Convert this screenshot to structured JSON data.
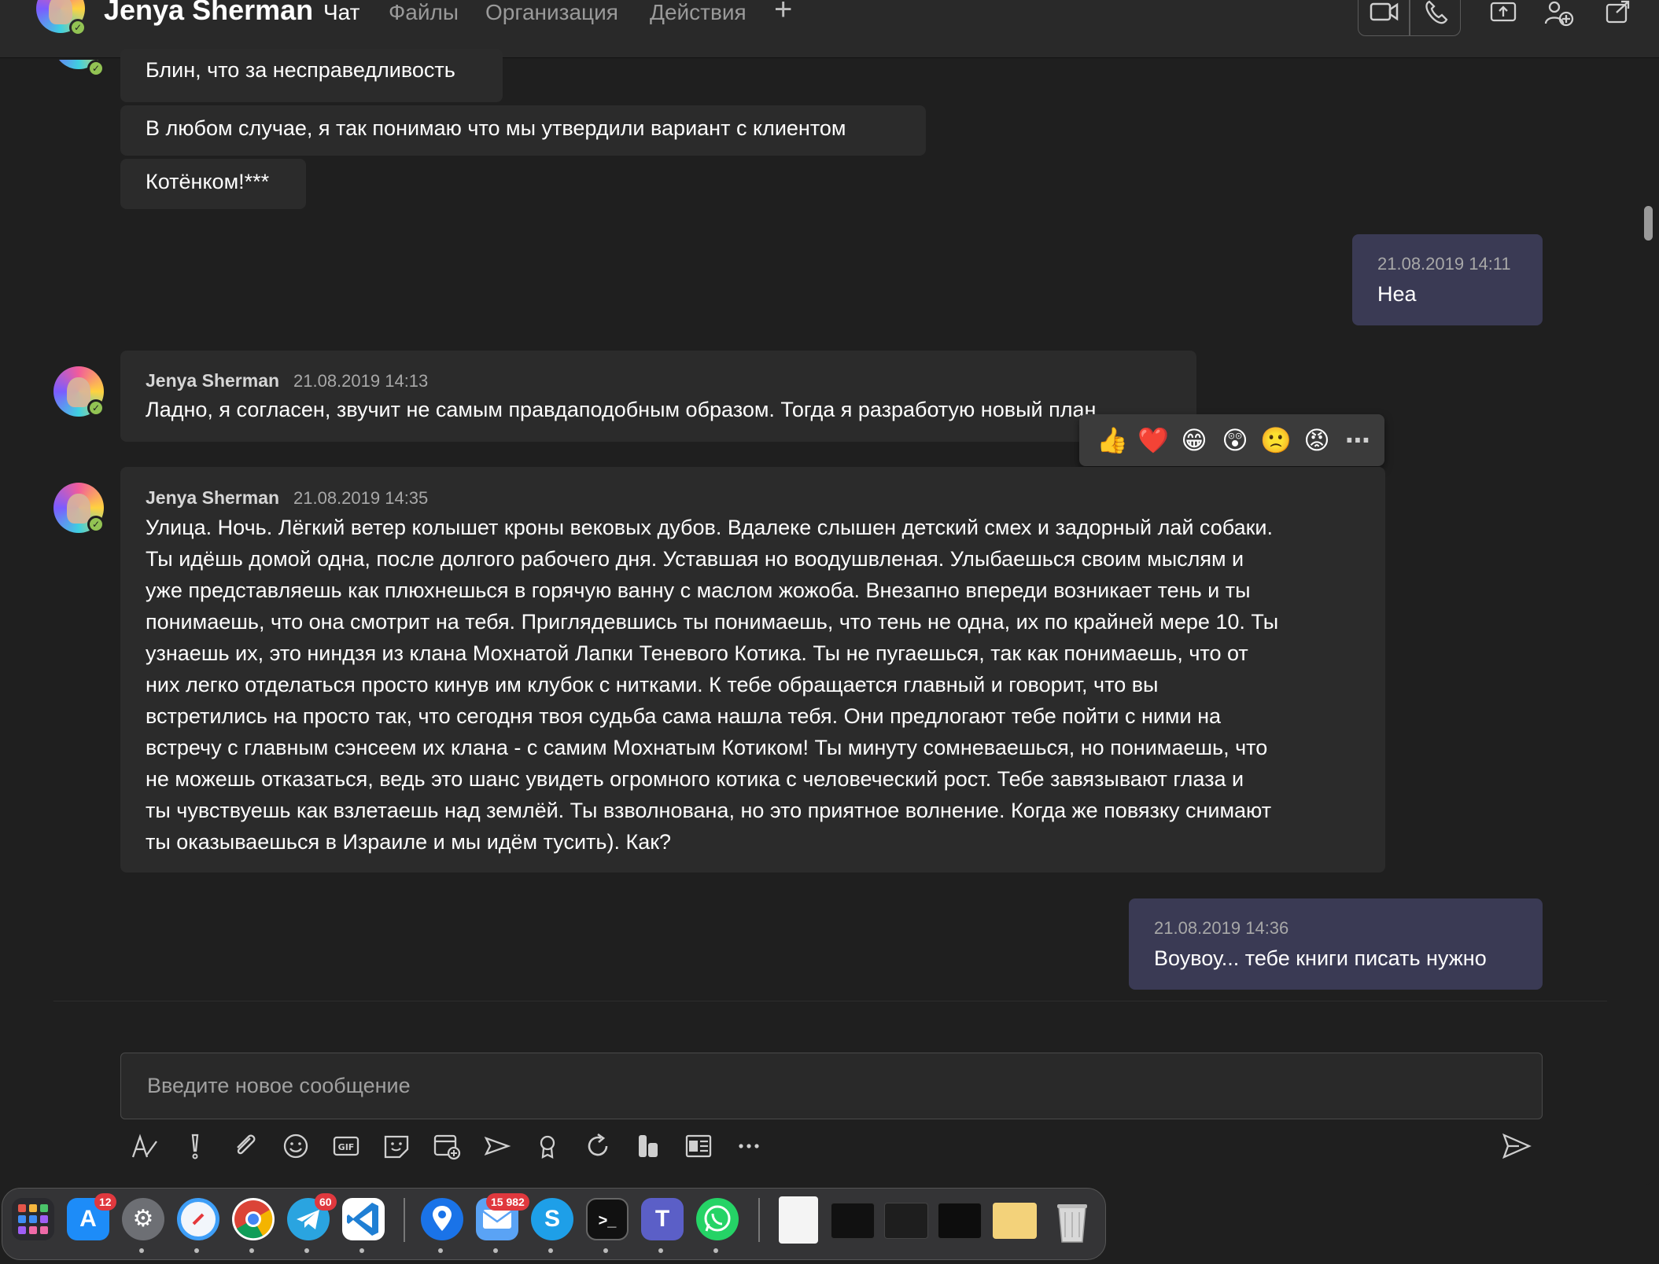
{
  "header": {
    "contact_name": "Jenya Sherman",
    "tabs": [
      {
        "label": "Чат",
        "active": true
      },
      {
        "label": "Файлы",
        "active": false
      },
      {
        "label": "Организация",
        "active": false
      },
      {
        "label": "Действия",
        "active": false
      }
    ],
    "add_tab_icon": "+",
    "accent_color": "#7f85f5"
  },
  "messages": [
    {
      "text": "Блин, что за несправедливость"
    },
    {
      "text": "В любом случае, я так понимаю что мы утвердили вариант с клиентом"
    },
    {
      "text": "Котёнком!***"
    },
    {
      "time": "21.08.2019 14:11",
      "text": "Неа"
    },
    {
      "sender": "Jenya Sherman",
      "time": "21.08.2019 14:13",
      "text": "Ладно, я согласен, звучит не самым правдаподобным образом. Тогда я разработую новый план"
    },
    {
      "sender": "Jenya Sherman",
      "time": "21.08.2019 14:35",
      "lines": [
        "Улица. Ночь. Лёгкий ветер колышет кроны вековых дубов. Вдалеке слышен детский смех и задорный лай собаки.",
        "Ты идёшь домой одна, после долгого рабочего дня. Уставшая но воодушвленая. Улыбаешься своим мыслям и",
        "уже представляешь как плюхнешься в горячую ванну с маслом жожоба. Внезапно впереди возникает тень и ты",
        "понимаешь, что она смотрит на тебя. Приглядевшись ты понимаешь, что тень не одна, их по крайней мере 10. Ты",
        "узнаешь их, это ниндзя из клана Мохнатой Лапки Теневого Котика. Ты не пугаешься, так как понимаешь, что от",
        "них легко отделаться просто кинув им клубок с нитками. К тебе обращается главный и говорит, что вы",
        "встретились на просто так, что сегодня твоя судьба сама нашла тебя. Они предлогают тебе пойти с ними на",
        "встречу с главным сэнсеем их клана - с самим Мохнатым Котиком! Ты минуту сомневаешься, но понимаешь, что",
        "не можешь отказаться, ведь это шанс увидеть огромного котика с человеческий рост. Тебе завязывают глаза и",
        "ты чувствуешь как взлетаешь над землёй. Ты взволнована, но это приятное волнение. Когда же повязку снимают",
        "ты оказываешься в Израиле и мы идём тусить). Как?"
      ]
    },
    {
      "time": "21.08.2019 14:36",
      "text": "Воувоу... тебе книги писать нужно"
    }
  ],
  "reactions": [
    "👍",
    "❤️",
    "😁",
    "😲",
    "🙁",
    "😡",
    "⋯"
  ],
  "compose": {
    "placeholder": "Введите новое сообщение"
  },
  "toolbar_icons": [
    "format-icon",
    "important-icon",
    "attach-icon",
    "emoji-icon",
    "gif-icon",
    "sticker-icon",
    "schedule-meeting-icon",
    "stream-icon",
    "praise-icon",
    "loop-icon",
    "apps-icon",
    "forms-icon",
    "more-icon",
    "send-icon"
  ],
  "dock": {
    "apps": [
      "Launchpad",
      "App Store",
      "System Preferences",
      "Safari",
      "Chrome",
      "Telegram",
      "VS Code",
      "Maps",
      "Mail",
      "Skype",
      "Terminal",
      "Teams",
      "WhatsApp"
    ],
    "badges": {
      "app_store": "12",
      "telegram": "60",
      "mail": "15 982"
    }
  },
  "colors": {
    "background": "#1f1f1f",
    "bubble_other": "#2b2b2b",
    "bubble_mine": "#3a3a54",
    "presence": "#92c353"
  }
}
